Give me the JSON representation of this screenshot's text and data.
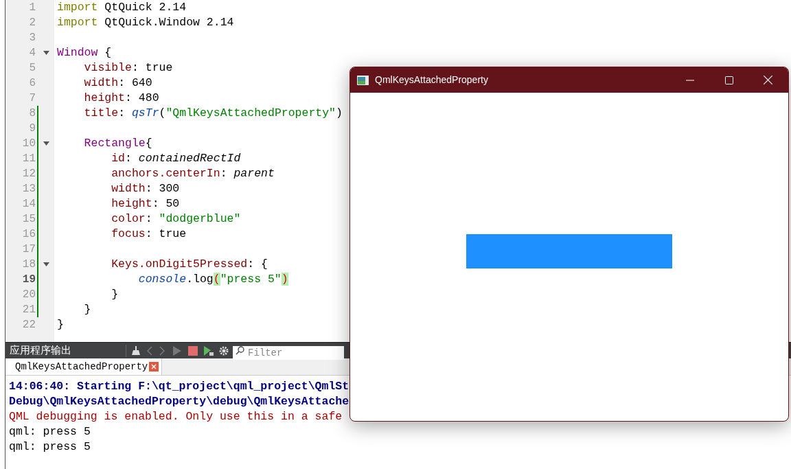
{
  "editor": {
    "lines": [
      {
        "number": "1",
        "current": false,
        "foldable": false,
        "changed": false,
        "tokens": [
          {
            "kind": "kw",
            "text": "import"
          },
          {
            "kind": "plain",
            "text": " QtQuick 2.14"
          }
        ]
      },
      {
        "number": "2",
        "current": false,
        "foldable": false,
        "changed": false,
        "tokens": [
          {
            "kind": "kw",
            "text": "import"
          },
          {
            "kind": "plain",
            "text": " QtQuick.Window 2.14"
          }
        ]
      },
      {
        "number": "3",
        "current": false,
        "foldable": false,
        "changed": false
      },
      {
        "number": "4",
        "current": false,
        "foldable": true,
        "changed": false,
        "tokens": [
          {
            "kind": "type",
            "text": "Window"
          },
          {
            "kind": "plain",
            "text": " {"
          }
        ]
      },
      {
        "number": "5",
        "current": false,
        "foldable": false,
        "changed": false,
        "tokens": [
          {
            "kind": "prop",
            "text": "    visible"
          },
          {
            "kind": "plain",
            "text": ": true"
          }
        ]
      },
      {
        "number": "6",
        "current": false,
        "foldable": false,
        "changed": false,
        "tokens": [
          {
            "kind": "prop",
            "text": "    width"
          },
          {
            "kind": "plain",
            "text": ": 640"
          }
        ]
      },
      {
        "number": "7",
        "current": false,
        "foldable": false,
        "changed": false,
        "tokens": [
          {
            "kind": "prop",
            "text": "    height"
          },
          {
            "kind": "plain",
            "text": ": 480"
          }
        ]
      },
      {
        "number": "8",
        "current": false,
        "foldable": false,
        "changed": true,
        "tokens": [
          {
            "kind": "prop",
            "text": "    title"
          },
          {
            "kind": "plain",
            "text": ": "
          },
          {
            "kind": "fn",
            "text": "qsTr"
          },
          {
            "kind": "plain",
            "text": "("
          },
          {
            "kind": "str",
            "text": "\"QmlKeysAttachedProperty\""
          },
          {
            "kind": "plain",
            "text": ")"
          }
        ]
      },
      {
        "number": "9",
        "current": false,
        "foldable": false,
        "changed": true
      },
      {
        "number": "10",
        "current": false,
        "foldable": true,
        "changed": true,
        "tokens": [
          {
            "kind": "type",
            "text": "    Rectangle"
          },
          {
            "kind": "plain",
            "text": "{"
          }
        ]
      },
      {
        "number": "11",
        "current": false,
        "foldable": false,
        "changed": true,
        "tokens": [
          {
            "kind": "prop",
            "text": "        id"
          },
          {
            "kind": "plain",
            "text": ": "
          },
          {
            "kind": "it",
            "text": "containedRectId"
          }
        ]
      },
      {
        "number": "12",
        "current": false,
        "foldable": false,
        "changed": true,
        "tokens": [
          {
            "kind": "prop",
            "text": "        anchors.centerIn"
          },
          {
            "kind": "plain",
            "text": ": "
          },
          {
            "kind": "it",
            "text": "parent"
          }
        ]
      },
      {
        "number": "13",
        "current": false,
        "foldable": false,
        "changed": true,
        "tokens": [
          {
            "kind": "prop",
            "text": "        width"
          },
          {
            "kind": "plain",
            "text": ": 300"
          }
        ]
      },
      {
        "number": "14",
        "current": false,
        "foldable": false,
        "changed": true,
        "tokens": [
          {
            "kind": "prop",
            "text": "        height"
          },
          {
            "kind": "plain",
            "text": ": 50"
          }
        ]
      },
      {
        "number": "15",
        "current": false,
        "foldable": false,
        "changed": true,
        "tokens": [
          {
            "kind": "prop",
            "text": "        color"
          },
          {
            "kind": "plain",
            "text": ": "
          },
          {
            "kind": "str",
            "text": "\"dodgerblue\""
          }
        ]
      },
      {
        "number": "16",
        "current": false,
        "foldable": false,
        "changed": true,
        "tokens": [
          {
            "kind": "prop",
            "text": "        focus"
          },
          {
            "kind": "plain",
            "text": ": true"
          }
        ]
      },
      {
        "number": "17",
        "current": false,
        "foldable": false,
        "changed": true
      },
      {
        "number": "18",
        "current": false,
        "foldable": true,
        "changed": true,
        "tokens": [
          {
            "kind": "prop",
            "text": "        Keys.onDigit5Pressed"
          },
          {
            "kind": "plain",
            "text": ": {"
          }
        ]
      },
      {
        "number": "19",
        "current": true,
        "foldable": false,
        "changed": true,
        "tokens": [
          {
            "kind": "fn",
            "text": "            console"
          },
          {
            "kind": "plain",
            "text": ".log"
          },
          {
            "kind": "paren",
            "text": "("
          },
          {
            "kind": "str",
            "text": "\"press 5\""
          },
          {
            "kind": "paren",
            "text": ")"
          }
        ]
      },
      {
        "number": "20",
        "current": false,
        "foldable": false,
        "changed": true,
        "tokens": [
          {
            "kind": "plain",
            "text": "        }"
          }
        ]
      },
      {
        "number": "21",
        "current": false,
        "foldable": false,
        "changed": true,
        "tokens": [
          {
            "kind": "plain",
            "text": "    }"
          }
        ]
      },
      {
        "number": "22",
        "current": false,
        "foldable": false,
        "changed": false,
        "tokens": [
          {
            "kind": "plain",
            "text": "}"
          }
        ]
      }
    ]
  },
  "output_pane": {
    "title": "应用程序输出",
    "filter": {
      "placeholder": "Filter"
    },
    "tabs": [
      {
        "label": "QmlKeysAttachedProperty",
        "selected": true
      }
    ],
    "lines": [
      {
        "kind": "info",
        "text": "14:06:40: Starting F:\\qt_project\\qml_project\\QmlSt"
      },
      {
        "kind": "info",
        "text": "Debug\\QmlKeysAttachedProperty\\debug\\QmlKeysAttache"
      },
      {
        "kind": "error",
        "text": "QML debugging is enabled. Only use this in a safe"
      },
      {
        "kind": "normal",
        "text": "qml: press 5"
      },
      {
        "kind": "normal",
        "text": "qml: press 5"
      }
    ]
  },
  "app_window": {
    "title": "QmlKeysAttachedProperty"
  }
}
